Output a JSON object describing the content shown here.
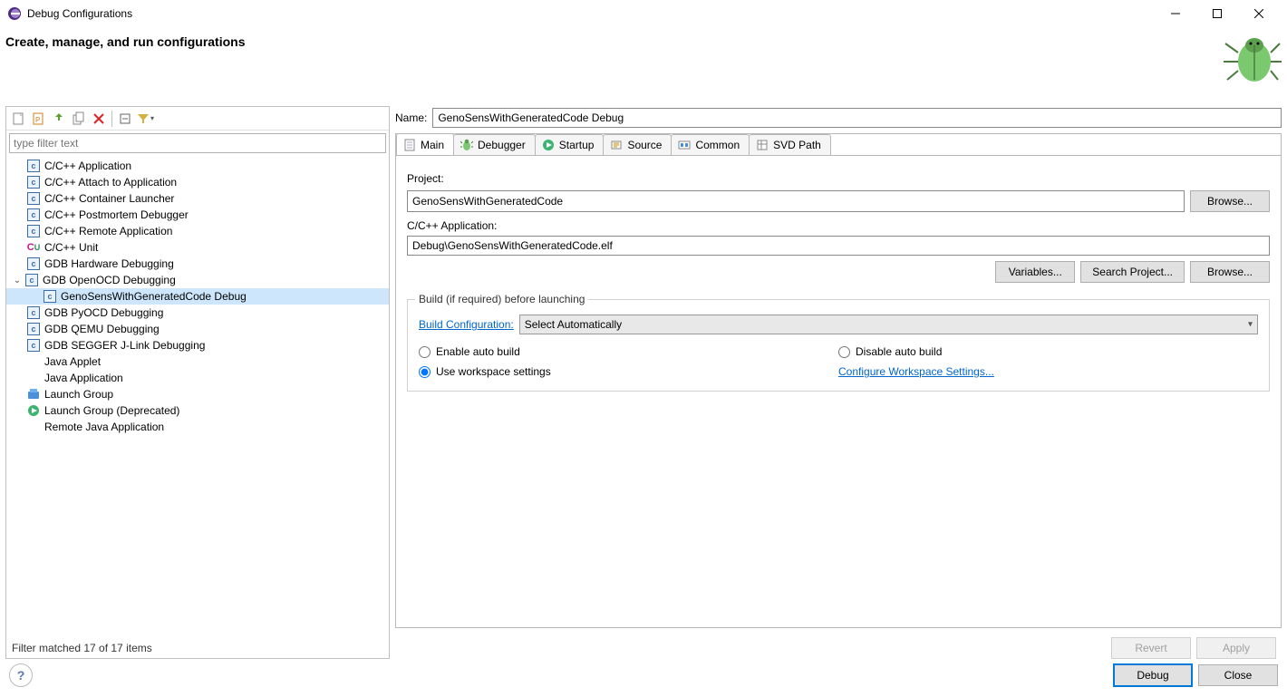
{
  "window_title": "Debug Configurations",
  "header_title": "Create, manage, and run configurations",
  "filter_placeholder": "type filter text",
  "tree": {
    "items": [
      {
        "icon": "c",
        "label": "C/C++ Application"
      },
      {
        "icon": "c",
        "label": "C/C++ Attach to Application"
      },
      {
        "icon": "c",
        "label": "C/C++ Container Launcher"
      },
      {
        "icon": "c",
        "label": "C/C++ Postmortem Debugger"
      },
      {
        "icon": "c",
        "label": "C/C++ Remote Application"
      },
      {
        "icon": "cu",
        "label": "C/C++ Unit"
      },
      {
        "icon": "c",
        "label": "GDB Hardware Debugging"
      },
      {
        "icon": "c",
        "label": "GDB OpenOCD Debugging",
        "expanded": true,
        "children": [
          {
            "icon": "c",
            "label": "GenoSensWithGeneratedCode Debug",
            "selected": true
          }
        ]
      },
      {
        "icon": "c",
        "label": "GDB PyOCD Debugging"
      },
      {
        "icon": "c",
        "label": "GDB QEMU Debugging"
      },
      {
        "icon": "c",
        "label": "GDB SEGGER J-Link Debugging"
      },
      {
        "icon": "none",
        "label": "Java Applet"
      },
      {
        "icon": "none",
        "label": "Java Application"
      },
      {
        "icon": "group",
        "label": "Launch Group"
      },
      {
        "icon": "play",
        "label": "Launch Group (Deprecated)"
      },
      {
        "icon": "none",
        "label": "Remote Java Application"
      }
    ]
  },
  "status": "Filter matched 17 of 17 items",
  "name_label": "Name:",
  "name_value": "GenoSensWithGeneratedCode Debug",
  "tabs": [
    {
      "id": "main",
      "label": "Main",
      "icon": "page"
    },
    {
      "id": "debugger",
      "label": "Debugger",
      "icon": "bug"
    },
    {
      "id": "startup",
      "label": "Startup",
      "icon": "play"
    },
    {
      "id": "source",
      "label": "Source",
      "icon": "source"
    },
    {
      "id": "common",
      "label": "Common",
      "icon": "common"
    },
    {
      "id": "svd",
      "label": "SVD Path",
      "icon": "svd"
    }
  ],
  "main": {
    "project_label": "Project:",
    "project_value": "GenoSensWithGeneratedCode",
    "browse1": "Browse...",
    "app_label": "C/C++ Application:",
    "app_value": "Debug\\GenoSensWithGeneratedCode.elf",
    "variables": "Variables...",
    "search_project": "Search Project...",
    "browse2": "Browse...",
    "build_section": "Build (if required) before launching",
    "build_config_label": "Build Configuration:",
    "build_config_value": "Select Automatically",
    "radio_enable": "Enable auto build",
    "radio_disable": "Disable auto build",
    "radio_workspace": "Use workspace settings",
    "config_link": "Configure Workspace Settings..."
  },
  "revert": "Revert",
  "apply": "Apply",
  "debug": "Debug",
  "close": "Close"
}
